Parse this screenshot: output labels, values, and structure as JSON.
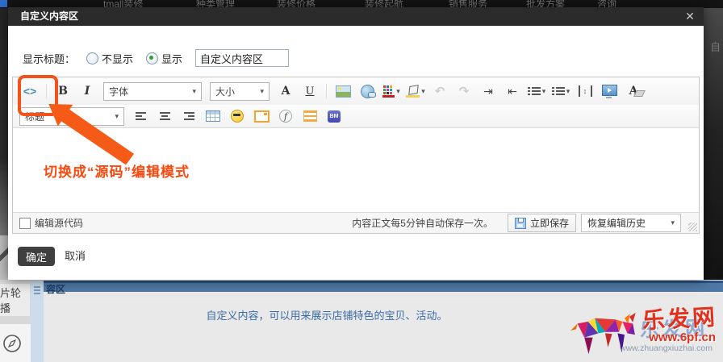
{
  "top_nav": {
    "items": [
      "tmall装修",
      "种类管理",
      "装修价格",
      "装修起航",
      "销售服务",
      "批发方案",
      "咨询"
    ]
  },
  "modal": {
    "title": "自定义内容区",
    "close_glyph": "✕",
    "form": {
      "label": "显示标题：",
      "radio_hide_label": "不显示",
      "radio_show_label": "显示",
      "title_value": "自定义内容区"
    },
    "toolbar": {
      "source_glyph": "<>",
      "bold": "B",
      "italic": "I",
      "font_family": "字体",
      "font_size": "大小",
      "forecolor_glyph": "A",
      "underline": "U",
      "undo_glyph": "↶",
      "redo_glyph": "↷",
      "indent_glyph": "⇥",
      "outdent_glyph": "⇤",
      "line_height_glyph": "↕",
      "caret": "▾",
      "heading": "标题",
      "flash_glyph": "f",
      "bm_label": "BM",
      "remove_format_glyph": "A"
    },
    "annotation": "切换成“源码”编辑模式",
    "bottom_bar": {
      "checkbox_label": "编辑源代码",
      "autosave_text": "内容正文每5分钟自动保存一次。",
      "save_label": "立即保存",
      "history_label": "恢复编辑历史"
    },
    "footer": {
      "ok": "确定",
      "cancel": "取消"
    }
  },
  "background": {
    "section_title_fragment": "容区",
    "sidebar_item_fragment": "片轮播",
    "dim_fragment": "自",
    "hint_text": "自定义内容，可以用来展示店铺特色的宝贝、活动。",
    "watermark": {
      "site": "乐发网",
      "url": "www.6pf.cn",
      "sub_url": "www.zhuangxiuzhai.com"
    }
  },
  "colors": {
    "accent_orange": "#f4521b",
    "annotation_red": "#f8490f",
    "blue_bar": "#4f79a5",
    "hint_blue": "#3a6ca8",
    "watermark_red": "#e2301f",
    "titlebar_dark": "#2b2b2b"
  }
}
